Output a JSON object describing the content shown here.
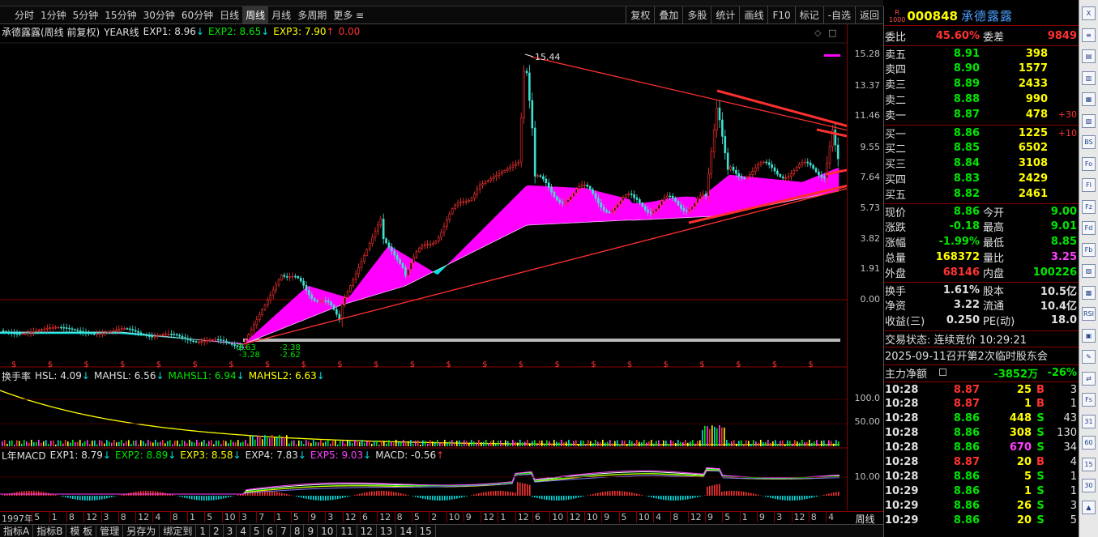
{
  "toolbar": {
    "periods": [
      "分时",
      "1分钟",
      "5分钟",
      "15分钟",
      "30分钟",
      "60分钟",
      "日线",
      "周线",
      "月线",
      "多周期",
      "更多"
    ],
    "active": "周线",
    "right_buttons": [
      "复权",
      "叠加",
      "多股",
      "统计",
      "画线",
      "F10",
      "标记",
      "-自选",
      "返回"
    ]
  },
  "legend_main": {
    "name": "承德露露(周线 前复权)",
    "indicator": "YEAR线",
    "exp1": "EXP1: 8.96",
    "exp2": "EXP2: 8.65",
    "exp3": "EXP3: 7.90",
    "extra": "0.00"
  },
  "price_axis": [
    "15.28",
    "13.37",
    "11.46",
    "9.55",
    "7.64",
    "5.73",
    "3.82",
    "1.91",
    "0.00"
  ],
  "annotations": {
    "high": "15.44",
    "low1": "-2.63",
    "low2": "-2.38",
    "low3": "-3.28",
    "low4": "-2.62"
  },
  "hsl_legend": {
    "name": "换手率",
    "hsl": "HSL: 4.09",
    "mahsl": "MAHSL: 6.56",
    "mahsl1": "MAHSL1: 6.94",
    "mahsl2": "MAHSL2: 6.63"
  },
  "hsl_axis": [
    "100.0",
    "50.00"
  ],
  "macd_legend": {
    "name": "L年MACD",
    "exp1": "EXP1: 8.79",
    "exp2": "EXP2: 8.89",
    "exp3": "EXP3: 8.58",
    "exp4": "EXP4: 7.83",
    "exp5": "EXP5: 9.03",
    "macd": "MACD: -0.56"
  },
  "macd_axis": [
    "10.00"
  ],
  "date_axis": [
    "1997年",
    "5",
    "1",
    "8",
    "12",
    "3",
    "8",
    "12",
    "4",
    "8",
    "1",
    "5",
    "10",
    "3",
    "7",
    "1",
    "5",
    "9",
    "3",
    "12",
    "6",
    "12",
    "8",
    "5",
    "2",
    "10",
    "9",
    "12",
    "1",
    "12",
    "6",
    "10",
    "12",
    "10",
    "9",
    "5",
    "10",
    "4",
    "8",
    "12",
    "9",
    "5",
    "1",
    "9",
    "3",
    "12",
    "8",
    "4"
  ],
  "date_axis_right": "周线",
  "bottom_tabs": [
    "指标A",
    "指标B",
    "模 板",
    "管理",
    "另存为",
    "绑定到",
    "1",
    "2",
    "3",
    "4",
    "5",
    "6",
    "7",
    "8",
    "9",
    "10",
    "11",
    "12",
    "13",
    "14",
    "15"
  ],
  "quote": {
    "badge": "R",
    "badge_sub": "1000",
    "code": "000848",
    "name": "承德露露",
    "weibi_label": "委比",
    "weibi": "45.60%",
    "weicha_label": "委差",
    "weicha": "9849",
    "sells": [
      {
        "label": "卖五",
        "price": "8.91",
        "vol": "398",
        "chg": ""
      },
      {
        "label": "卖四",
        "price": "8.90",
        "vol": "1577",
        "chg": ""
      },
      {
        "label": "卖三",
        "price": "8.89",
        "vol": "2433",
        "chg": ""
      },
      {
        "label": "卖二",
        "price": "8.88",
        "vol": "990",
        "chg": ""
      },
      {
        "label": "卖一",
        "price": "8.87",
        "vol": "478",
        "chg": "+30"
      }
    ],
    "buys": [
      {
        "label": "买一",
        "price": "8.86",
        "vol": "1225",
        "chg": "+10"
      },
      {
        "label": "买二",
        "price": "8.85",
        "vol": "6502",
        "chg": ""
      },
      {
        "label": "买三",
        "price": "8.84",
        "vol": "3108",
        "chg": ""
      },
      {
        "label": "买四",
        "price": "8.83",
        "vol": "2429",
        "chg": ""
      },
      {
        "label": "买五",
        "price": "8.82",
        "vol": "2461",
        "chg": ""
      }
    ],
    "stats": [
      {
        "l1": "现价",
        "v1": "8.86",
        "c1": "green",
        "l2": "今开",
        "v2": "9.00",
        "c2": "green"
      },
      {
        "l1": "涨跌",
        "v1": "-0.18",
        "c1": "green",
        "l2": "最高",
        "v2": "9.01",
        "c2": "green"
      },
      {
        "l1": "涨幅",
        "v1": "-1.99%",
        "c1": "green",
        "l2": "最低",
        "v2": "8.85",
        "c2": "green"
      },
      {
        "l1": "总量",
        "v1": "168372",
        "c1": "yellow",
        "l2": "量比",
        "v2": "3.25",
        "c2": "mag"
      },
      {
        "l1": "外盘",
        "v1": "68146",
        "c1": "red",
        "l2": "内盘",
        "v2": "100226",
        "c2": "green"
      }
    ],
    "fin": [
      {
        "l1": "换手",
        "v1": "1.61%",
        "l2": "股本",
        "v2": "10.5亿"
      },
      {
        "l1": "净资",
        "v1": "3.22",
        "l2": "流通",
        "v2": "10.4亿"
      },
      {
        "l1": "收益(三)",
        "v1": "0.250",
        "l2": "PE(动)",
        "v2": "18.0"
      }
    ],
    "trade_status": "交易状态: 连续竞价 10:29:21",
    "notice": "2025-09-11召开第2次临时股东会",
    "main_flow_label": "主力净额",
    "main_flow_val": "-3852万",
    "main_flow_pct": "-26%",
    "ticks": [
      {
        "t": "10:28",
        "p": "8.87",
        "v": "25",
        "bs": "B",
        "n": "3",
        "vc": "yellow"
      },
      {
        "t": "10:28",
        "p": "8.87",
        "v": "1",
        "bs": "B",
        "n": "1",
        "vc": "yellow"
      },
      {
        "t": "10:28",
        "p": "8.86",
        "v": "448",
        "bs": "S",
        "n": "43",
        "vc": "yellow"
      },
      {
        "t": "10:28",
        "p": "8.86",
        "v": "308",
        "bs": "S",
        "n": "130",
        "vc": "yellow"
      },
      {
        "t": "10:28",
        "p": "8.86",
        "v": "670",
        "bs": "S",
        "n": "34",
        "vc": "mag"
      },
      {
        "t": "10:28",
        "p": "8.87",
        "v": "20",
        "bs": "B",
        "n": "4",
        "vc": "yellow"
      },
      {
        "t": "10:28",
        "p": "8.86",
        "v": "5",
        "bs": "S",
        "n": "1",
        "vc": "yellow"
      },
      {
        "t": "10:29",
        "p": "8.86",
        "v": "1",
        "bs": "S",
        "n": "1",
        "vc": "yellow"
      },
      {
        "t": "10:29",
        "p": "8.86",
        "v": "26",
        "bs": "S",
        "n": "3",
        "vc": "yellow"
      },
      {
        "t": "10:29",
        "p": "8.86",
        "v": "20",
        "bs": "S",
        "n": "5",
        "vc": "yellow"
      }
    ]
  },
  "sidebar_icons": [
    "X",
    "≡",
    "▤",
    "▥",
    "▦",
    "▧",
    "BS",
    "Fo",
    "FI",
    "Fz",
    "Fd",
    "Fb",
    "▨",
    "▩",
    "RSI",
    "▣",
    "✎",
    "⇄",
    "Fs",
    "31",
    "60",
    "15",
    "30",
    "▲"
  ],
  "colors": {
    "up": "#ff3232",
    "down": "#00e600",
    "ma_fill": "#ff00ff",
    "ma_fill2": "#00e0e0",
    "arrow": "#ff3030"
  }
}
